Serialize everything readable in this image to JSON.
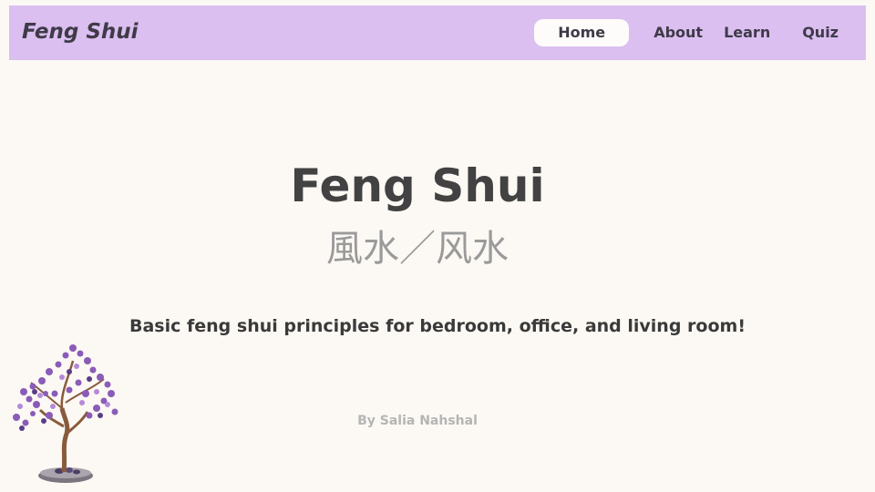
{
  "nav": {
    "brand": "Feng Shui",
    "links": [
      {
        "label": "Home",
        "active": true
      },
      {
        "label": "About",
        "active": false
      },
      {
        "label": "Learn",
        "active": false
      },
      {
        "label": "Quiz",
        "active": false
      }
    ]
  },
  "hero": {
    "title": "Feng Shui",
    "subtitle": "風水／风水",
    "tagline": "Basic feng shui principles for bedroom, office, and living room!",
    "byline": "By Salia Nahshal"
  },
  "colors": {
    "navbar_bg": "#dbbff0",
    "page_bg": "#fcf9f4",
    "active_tab_bg": "#fefcfa",
    "tree_leaves": "#8a5cb8"
  },
  "decor": {
    "image": "gemstone-tree-icon"
  }
}
